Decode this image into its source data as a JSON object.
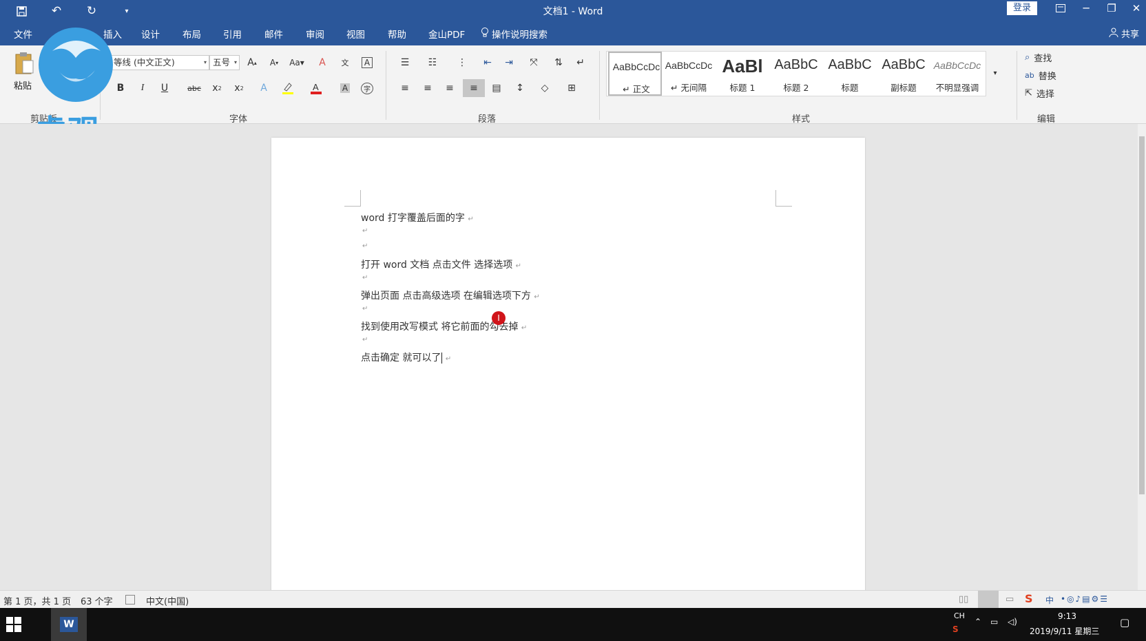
{
  "window": {
    "title": "文档1  -  Word",
    "login": "登录"
  },
  "tabs": [
    "文件",
    "插入",
    "设计",
    "布局",
    "引用",
    "邮件",
    "审阅",
    "视图",
    "帮助",
    "金山PDF"
  ],
  "tell_me": "操作说明搜索",
  "share": "共享",
  "ribbon": {
    "paste": "粘贴",
    "clipboard_label": "剪贴板",
    "font_name": "等线 (中文正文)",
    "font_size": "五号",
    "font_group": "字体",
    "para_group": "段落",
    "styles_group": "样式",
    "edit_group": "编辑",
    "styles": [
      {
        "sample": "AaBbCcDc",
        "name": "↵ 正文"
      },
      {
        "sample": "AaBbCcDc",
        "name": "↵ 无间隔"
      },
      {
        "sample": "AaBl",
        "name": "标题 1"
      },
      {
        "sample": "AaBbC",
        "name": "标题 2"
      },
      {
        "sample": "AaBbC",
        "name": "标题"
      },
      {
        "sample": "AaBbC",
        "name": "副标题"
      },
      {
        "sample": "AaBbCcDc",
        "name": "不明显强调"
      }
    ],
    "find": "查找",
    "replace": "替换",
    "select": "选择"
  },
  "document": {
    "lines": [
      "word 打字覆盖后面的字",
      "打开 word 文档   点击文件   选择选项",
      "弹出页面   点击高级选项   在编辑选项下方",
      "找到使用改写模式   将它前面的勾去掉",
      "点击确定   就可以了"
    ],
    "para_mark": "↵"
  },
  "status": {
    "page": "第 1 页，共 1 页",
    "words": "63 个字",
    "language": "中文(中国)"
  },
  "taskbar": {
    "lang": "CH",
    "time": "9:13",
    "date": "2019/9/11 星期三",
    "ime": "中"
  },
  "watermark": "虎观",
  "colors": {
    "accent": "#2b579a",
    "cursor": "#d0141a",
    "logo": "#3a9ee0"
  }
}
